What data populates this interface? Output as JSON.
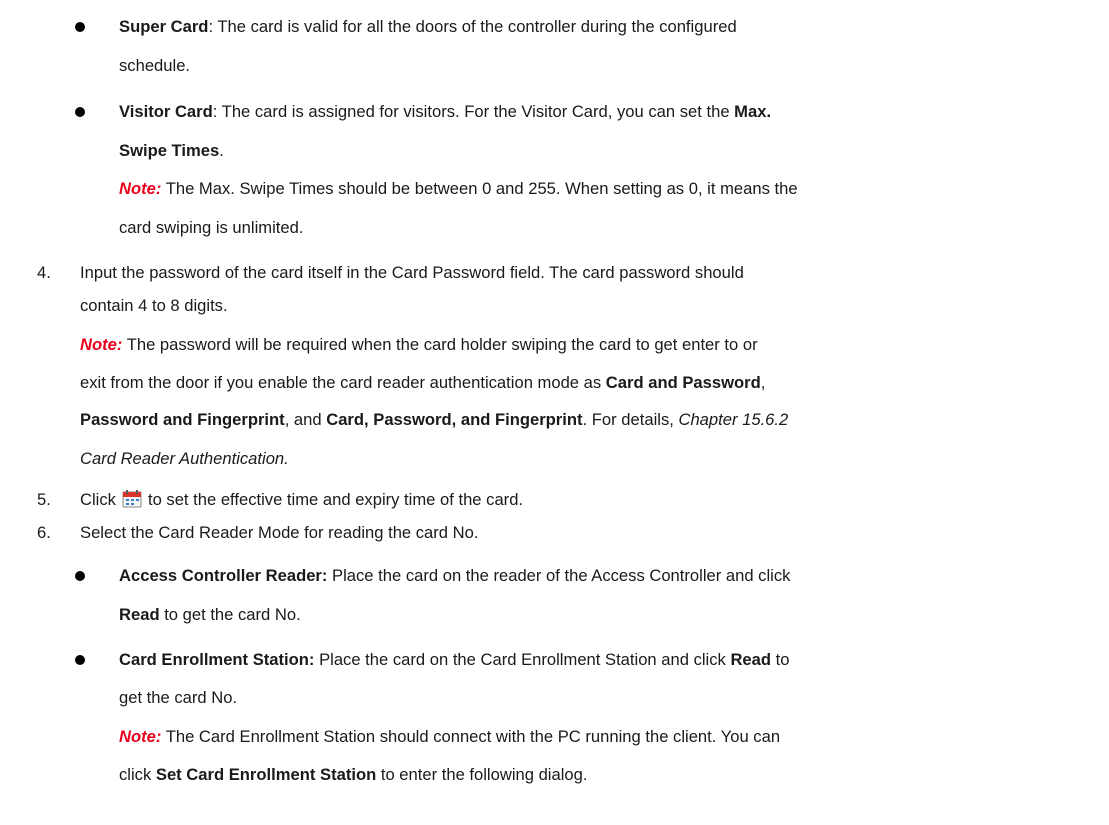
{
  "super_card": {
    "term": "Super Card",
    "text1": ": The card is valid for all the doors of the controller during the configured",
    "text2": "schedule."
  },
  "visitor_card": {
    "term": "Visitor Card",
    "text1": ": The card is assigned for visitors. For the Visitor Card, you can set the ",
    "bold1": "Max.",
    "bold2": "Swipe Times",
    "text2": ".",
    "note_label": "Note:",
    "note1": " The Max. Swipe Times should be between 0 and 255. When setting as 0, it means the",
    "note2": "card swiping is unlimited."
  },
  "step4": {
    "num": "4.",
    "text1": "Input the password of the card itself in the Card Password field. The card password should",
    "text2": "contain 4 to 8 digits.",
    "note_label": "Note:",
    "note1": " The password will be required when the card holder swiping the card to get enter to or",
    "note2a": "exit from the door if you enable the card reader authentication mode as ",
    "note2b": "Card and Password",
    "note2c": ",",
    "note3a": "Password and Fingerprint",
    "note3b": ", and ",
    "note3c": "Card, Password, and Fingerprint",
    "note3d": ". For details, ",
    "note3e": "Chapter 15.6.2",
    "note4": "Card Reader Authentication."
  },
  "step5": {
    "num": "5.",
    "text_a": "Click",
    "text_b": "to set the effective time and expiry time of the card."
  },
  "step6": {
    "num": "6.",
    "text": "Select the Card Reader Mode for reading the card No."
  },
  "access_controller_reader": {
    "term": "Access Controller Reader:",
    "text1": " Place the card on the reader of the Access Controller and click",
    "bold": "Read",
    "text2": " to get the card No."
  },
  "card_enrollment_station": {
    "term": "Card Enrollment Station:",
    "text1": " Place the card on the Card Enrollment Station and click ",
    "bold": "Read",
    "text1b": " to",
    "text2": "get the card No.",
    "note_label": "Note:",
    "note1": " The Card Enrollment Station should connect with the PC running the client. You can",
    "note2a": "click ",
    "note2b": "Set Card Enrollment Station",
    "note2c": " to enter the following dialog."
  },
  "icons": {
    "calendar": "calendar-icon"
  }
}
